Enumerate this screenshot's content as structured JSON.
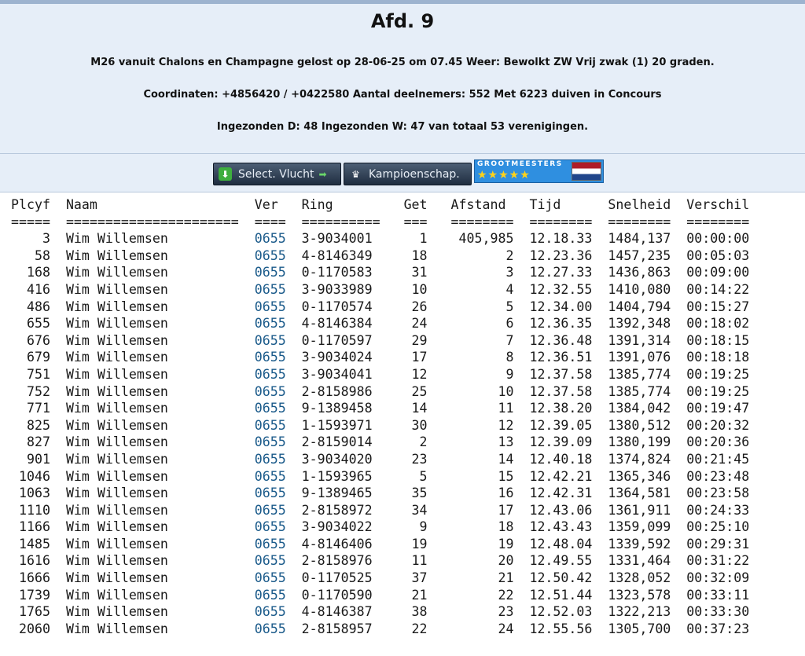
{
  "header": {
    "title": "Afd. 9",
    "line1": "M26 vanuit Chalons en Champagne gelost op 28-06-25 om 07.45 Weer: Bewolkt ZW Vrij zwak (1) 20 graden.",
    "line2": "Coordinaten: +4856420 / +0422580 Aantal deelnemers: 552 Met 6223 duiven in Concours",
    "line3": "Ingezonden D: 48 Ingezonden W: 47 van totaal 53 verenigingen."
  },
  "buttons": {
    "select_label": "Select. Vlucht",
    "kampioen_label": "Kampioenschap.",
    "grootmeesters_label": "GROOTMEESTERS",
    "stars": "★★★★★"
  },
  "table": {
    "columns": [
      "Plcyf",
      "Naam",
      "Ver",
      "Ring",
      "Get",
      "Afstand",
      "Tijd",
      "Snelheid",
      "Verschil"
    ],
    "separators": [
      "=====",
      "======================",
      "====",
      "==========",
      "===",
      "========",
      "========",
      "========",
      "========"
    ],
    "rows": [
      [
        "3",
        "Wim Willemsen",
        "0655",
        "3-9034001",
        "1",
        "405,985",
        "12.18.33",
        "1484,137",
        "00:00:00"
      ],
      [
        "58",
        "Wim Willemsen",
        "0655",
        "4-8146349",
        "18",
        "2",
        "12.23.36",
        "1457,235",
        "00:05:03"
      ],
      [
        "168",
        "Wim Willemsen",
        "0655",
        "0-1170583",
        "31",
        "3",
        "12.27.33",
        "1436,863",
        "00:09:00"
      ],
      [
        "416",
        "Wim Willemsen",
        "0655",
        "3-9033989",
        "10",
        "4",
        "12.32.55",
        "1410,080",
        "00:14:22"
      ],
      [
        "486",
        "Wim Willemsen",
        "0655",
        "0-1170574",
        "26",
        "5",
        "12.34.00",
        "1404,794",
        "00:15:27"
      ],
      [
        "655",
        "Wim Willemsen",
        "0655",
        "4-8146384",
        "24",
        "6",
        "12.36.35",
        "1392,348",
        "00:18:02"
      ],
      [
        "676",
        "Wim Willemsen",
        "0655",
        "0-1170597",
        "29",
        "7",
        "12.36.48",
        "1391,314",
        "00:18:15"
      ],
      [
        "679",
        "Wim Willemsen",
        "0655",
        "3-9034024",
        "17",
        "8",
        "12.36.51",
        "1391,076",
        "00:18:18"
      ],
      [
        "751",
        "Wim Willemsen",
        "0655",
        "3-9034041",
        "12",
        "9",
        "12.37.58",
        "1385,774",
        "00:19:25"
      ],
      [
        "752",
        "Wim Willemsen",
        "0655",
        "2-8158986",
        "25",
        "10",
        "12.37.58",
        "1385,774",
        "00:19:25"
      ],
      [
        "771",
        "Wim Willemsen",
        "0655",
        "9-1389458",
        "14",
        "11",
        "12.38.20",
        "1384,042",
        "00:19:47"
      ],
      [
        "825",
        "Wim Willemsen",
        "0655",
        "1-1593971",
        "30",
        "12",
        "12.39.05",
        "1380,512",
        "00:20:32"
      ],
      [
        "827",
        "Wim Willemsen",
        "0655",
        "2-8159014",
        "2",
        "13",
        "12.39.09",
        "1380,199",
        "00:20:36"
      ],
      [
        "901",
        "Wim Willemsen",
        "0655",
        "3-9034020",
        "23",
        "14",
        "12.40.18",
        "1374,824",
        "00:21:45"
      ],
      [
        "1046",
        "Wim Willemsen",
        "0655",
        "1-1593965",
        "5",
        "15",
        "12.42.21",
        "1365,346",
        "00:23:48"
      ],
      [
        "1063",
        "Wim Willemsen",
        "0655",
        "9-1389465",
        "35",
        "16",
        "12.42.31",
        "1364,581",
        "00:23:58"
      ],
      [
        "1110",
        "Wim Willemsen",
        "0655",
        "2-8158972",
        "34",
        "17",
        "12.43.06",
        "1361,911",
        "00:24:33"
      ],
      [
        "1166",
        "Wim Willemsen",
        "0655",
        "3-9034022",
        "9",
        "18",
        "12.43.43",
        "1359,099",
        "00:25:10"
      ],
      [
        "1485",
        "Wim Willemsen",
        "0655",
        "4-8146406",
        "19",
        "19",
        "12.48.04",
        "1339,592",
        "00:29:31"
      ],
      [
        "1616",
        "Wim Willemsen",
        "0655",
        "2-8158976",
        "11",
        "20",
        "12.49.55",
        "1331,464",
        "00:31:22"
      ],
      [
        "1666",
        "Wim Willemsen",
        "0655",
        "0-1170525",
        "37",
        "21",
        "12.50.42",
        "1328,052",
        "00:32:09"
      ],
      [
        "1739",
        "Wim Willemsen",
        "0655",
        "0-1170590",
        "21",
        "22",
        "12.51.44",
        "1323,578",
        "00:33:11"
      ],
      [
        "1765",
        "Wim Willemsen",
        "0655",
        "4-8146387",
        "38",
        "23",
        "12.52.03",
        "1322,213",
        "00:33:30"
      ],
      [
        "2060",
        "Wim Willemsen",
        "0655",
        "2-8158957",
        "22",
        "24",
        "12.55.56",
        "1305,700",
        "00:37:23"
      ]
    ]
  }
}
